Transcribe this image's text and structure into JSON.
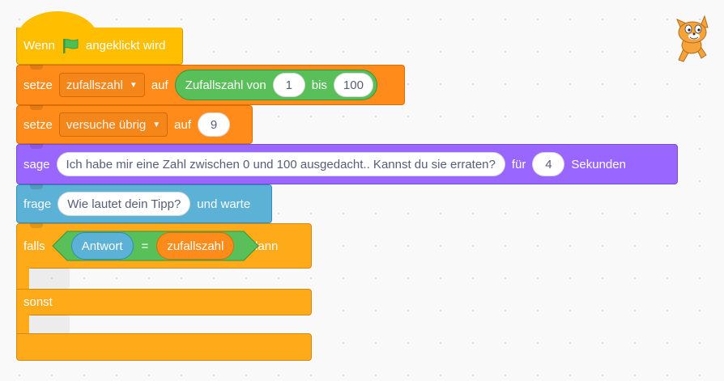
{
  "hat": {
    "when": "Wenn",
    "clicked": "angeklickt wird",
    "flag_icon": "green-flag-icon",
    "flag_color": "#4cbf56"
  },
  "set1": {
    "verb": "setze",
    "variable": "zufallszahl",
    "to": "auf",
    "reporter": {
      "label": "Zufallszahl von",
      "from": "1",
      "between": "bis",
      "to": "100"
    }
  },
  "set2": {
    "verb": "setze",
    "variable": "versuche übrig",
    "to": "auf",
    "value": "9"
  },
  "say": {
    "verb": "sage",
    "message": "Ich habe mir eine  Zahl zwischen 0 und 100 ausgedacht.. Kannst du sie erraten?",
    "for": "für",
    "seconds": "4",
    "unit": "Sekunden"
  },
  "ask": {
    "verb": "frage",
    "question": "Wie lautet dein Tipp?",
    "wait": "und warte"
  },
  "ifelse": {
    "if": "falls",
    "left": "Antwort",
    "op": "=",
    "right": "zufallszahl",
    "then": ", dann",
    "else": "sonst"
  },
  "colors": {
    "events": "#ffbf00",
    "variables": "#ff8c1a",
    "looks": "#9966ff",
    "sensing": "#5cb1d6",
    "control": "#ffab19",
    "operators": "#59c059"
  },
  "sprite": {
    "icon": "scratch-cat-icon"
  }
}
